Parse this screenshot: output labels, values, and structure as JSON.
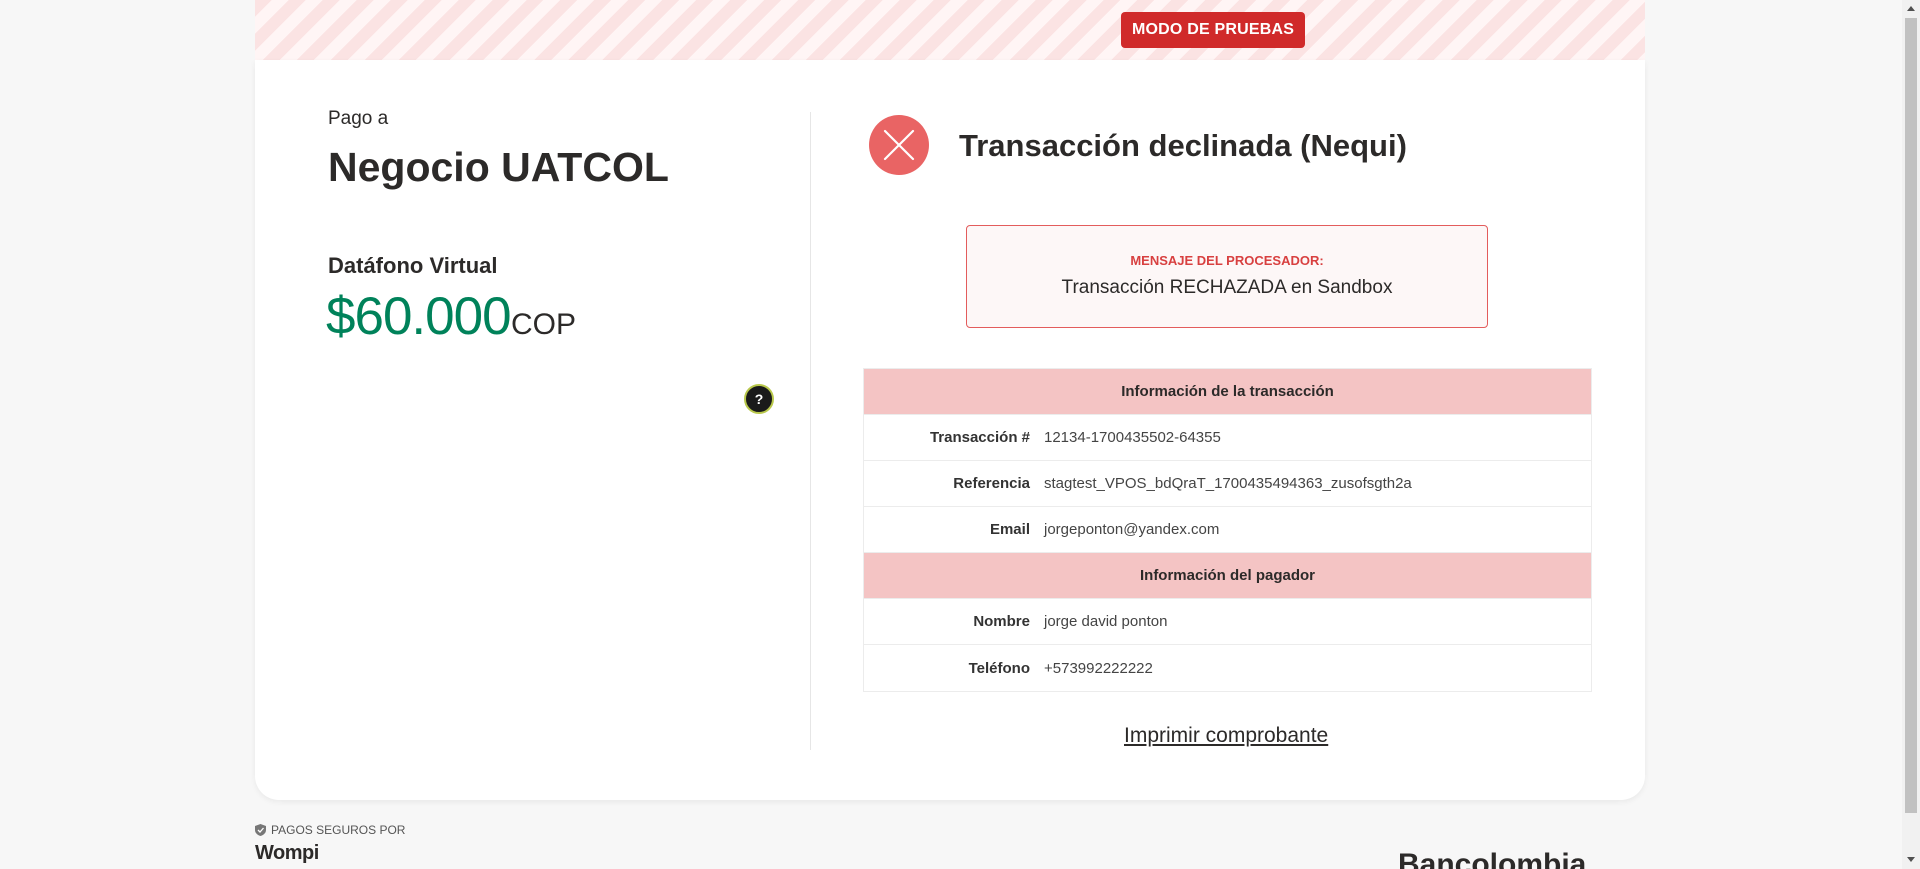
{
  "banner": {
    "badge": "MODO DE PRUEBAS"
  },
  "merchant": {
    "pay_to_label": "Pago a",
    "name": "Negocio UATCOL",
    "product": "Datáfono Virtual",
    "amount": "$60.000",
    "currency": "COP",
    "help_label": "?"
  },
  "status": {
    "title": "Transacción declinada (Nequi)",
    "color": "#e96464"
  },
  "processor": {
    "label": "MENSAJE DEL PROCESADOR:",
    "message": "Transacción RECHAZADA en Sandbox"
  },
  "transaction_info": {
    "header": "Información de la transacción",
    "rows": [
      {
        "label": "Transacción #",
        "value": "12134-1700435502-64355"
      },
      {
        "label": "Referencia",
        "value": "stagtest_VPOS_bdQraT_1700435494363_zusofsgth2a"
      },
      {
        "label": "Email",
        "value": "jorgeponton@yandex.com"
      }
    ]
  },
  "payer_info": {
    "header": "Información del pagador",
    "rows": [
      {
        "label": "Nombre",
        "value": "jorge david ponton"
      },
      {
        "label": "Teléfono",
        "value": "+573992222222"
      }
    ]
  },
  "actions": {
    "print": "Imprimir comprobante"
  },
  "footer": {
    "secure_label": "PAGOS SEGUROS POR",
    "wompi": "Wompi",
    "bancolombia": "Bancolombia"
  },
  "colors": {
    "accent_green": "#00825a",
    "error_red": "#d02a2a",
    "table_header": "#f4c4c4"
  }
}
